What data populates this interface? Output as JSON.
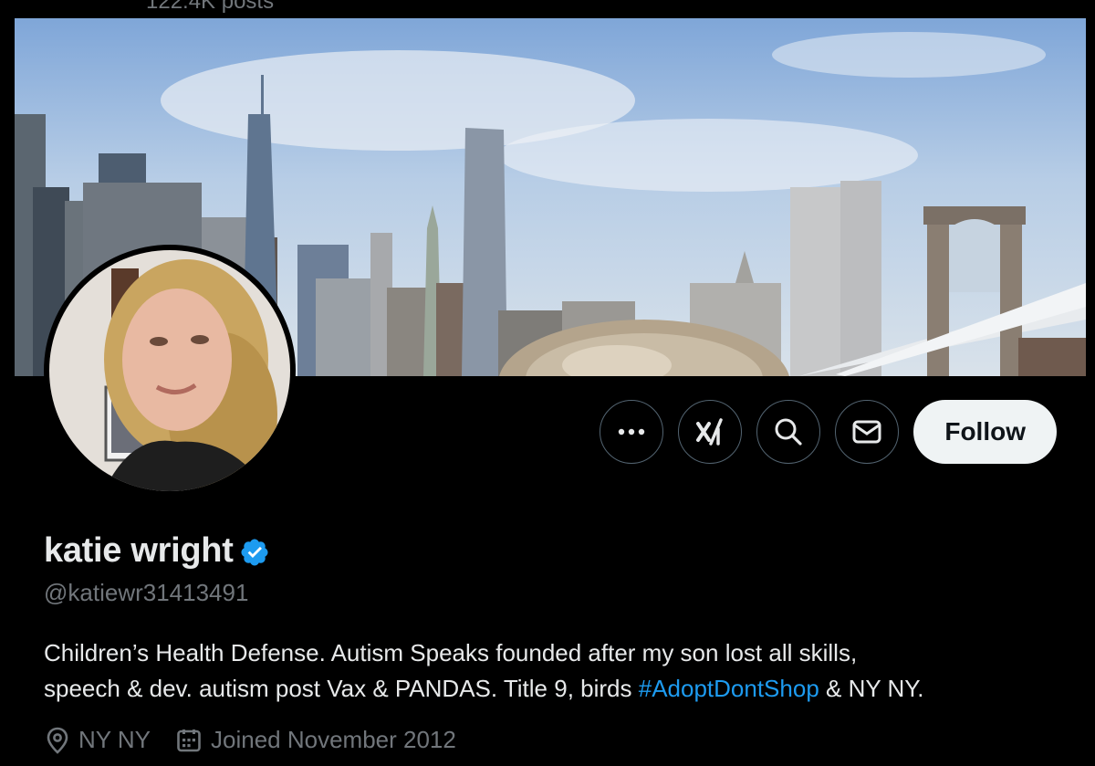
{
  "header": {
    "post_count": "122.4K posts"
  },
  "banner": {
    "description_icon": "nyc-skyline-photo"
  },
  "avatar": {
    "icon": "profile-photo"
  },
  "actions": {
    "more_icon": "more-icon",
    "grok_icon": "grok-icon",
    "search_icon": "search-icon",
    "message_icon": "message-icon",
    "follow_label": "Follow"
  },
  "profile": {
    "name": "katie wright",
    "handle": "@katiewr31413491",
    "bio_line1": "Children’s Health Defense. Autism Speaks founded after my son lost all skills,",
    "bio_line2_before": "speech & dev. autism post Vax & PANDAS. Title 9, birds ",
    "bio_hashtag": "#AdoptDontShop",
    "bio_line2_after": " & NY NY.",
    "location": "NY NY",
    "joined": "Joined November 2012"
  },
  "colors": {
    "background": "#000000",
    "accent": "#1d9bf0",
    "muted": "#71767b",
    "text": "#e7e9ea",
    "follow_bg": "#eff3f4"
  }
}
